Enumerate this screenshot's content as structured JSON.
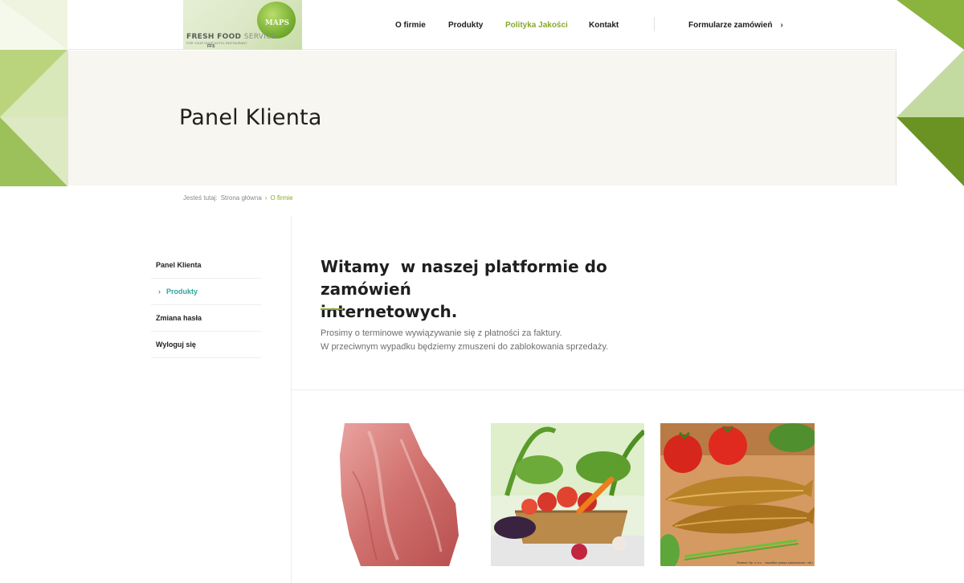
{
  "header": {
    "logo": {
      "brand_main": "FRESH FOOD",
      "brand_second": "SERVICE",
      "tagline": "FOR YOUR SHOP HOTEL RESTAURANT",
      "sub": "FFS",
      "apple_label": "MAPS"
    },
    "nav": [
      {
        "label": "O firmie",
        "active": false
      },
      {
        "label": "Produkty",
        "active": false
      },
      {
        "label": "Polityka Jakości",
        "active": true
      },
      {
        "label": "Kontakt",
        "active": false
      }
    ],
    "orders_label": "Formularze zamówień",
    "orders_icon": "chevron-right-icon"
  },
  "hero": {
    "title": "Panel Klienta"
  },
  "breadcrumb": {
    "prefix": "Jesteś tutaj:",
    "home": "Strona główna",
    "separator_icon": "chevron-right-icon",
    "current": "O firmie"
  },
  "sidebar": {
    "items": [
      {
        "label": "Panel Klienta",
        "active": false
      },
      {
        "label": "Produkty",
        "active": true
      },
      {
        "label": "Zmiana hasła",
        "active": false
      },
      {
        "label": "Wyloguj się",
        "active": false
      }
    ]
  },
  "main": {
    "title": "Witamy  w naszej platformie do zamówień\ninternetowych.",
    "notice_line1": "Prosimy o terminowe wywiązywanie się z płatności za faktury.",
    "notice_line2": "W przeciwnym wypadku będziemy zmuszeni do zablokowania sprzedaży.",
    "photos": [
      {
        "subject": "raw-meat"
      },
      {
        "subject": "vegetables-basket"
      },
      {
        "subject": "smoked-fish-tomatoes",
        "credit": "Seamor Sp. z o.o. - wszelkie prawa zastrzeżone / all r"
      }
    ]
  },
  "colors": {
    "accent_green": "#86a92a",
    "active_teal": "#2fa7a0",
    "hero_bg": "#f7f6f0",
    "triangle_light": "#c6dc9a",
    "triangle_mid": "#a3c560",
    "triangle_dark": "#6b9324"
  }
}
